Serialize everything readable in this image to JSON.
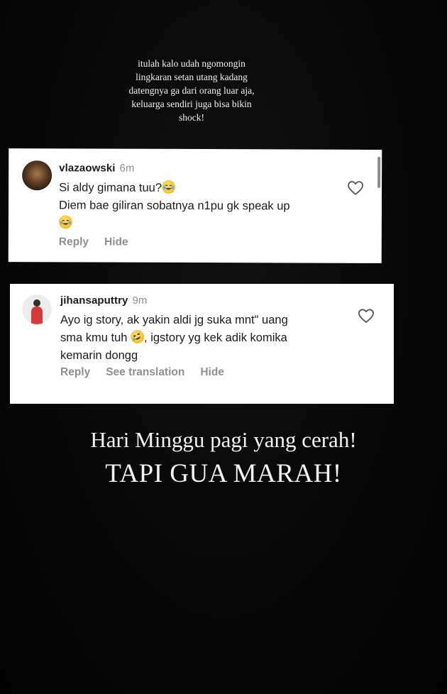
{
  "story": {
    "top_caption": "itulah kalo udah ngomongin\nlingkaran setan utang kadang\ndatengnya ga dari orang luar aja,\nkeluarga sendiri juga bisa bikin\nshock!",
    "bottom_caption_line1": "Hari Minggu pagi yang cerah!",
    "bottom_caption_line2": "TAPI GUA MARAH!"
  },
  "comments": [
    {
      "username": "vlazaowski",
      "time": "6m",
      "line1": "Si aldy gimana tuu?",
      "line2": "Diem bae giliran sobatnya n1pu gk speak up",
      "emojis": [
        "face-with-tears-of-joy",
        "face-with-tears-of-joy"
      ],
      "actions": [
        "Reply",
        "Hide"
      ]
    },
    {
      "username": "jihansaputtry",
      "time": "9m",
      "line1": "Ayo ig story, ak yakin aldi jg suka mnt\" uang",
      "line2_before_emoji": "sma kmu tuh ",
      "line2_after_emoji": ", igstory yg kek adik komika",
      "line3": "kemarin dongg",
      "emojis": [
        "rolling-on-floor-laughing"
      ],
      "actions": [
        "Reply",
        "See translation",
        "Hide"
      ]
    }
  ],
  "colors": {
    "background": "#080808",
    "card": "#ffffff",
    "muted_text": "#8e8e8e",
    "emoji_yellow": "#f7c437"
  },
  "icons": {
    "like": "heart-outline-icon",
    "emoji_laugh": "face-with-tears-of-joy",
    "emoji_rofl": "rolling-on-floor-laughing"
  }
}
